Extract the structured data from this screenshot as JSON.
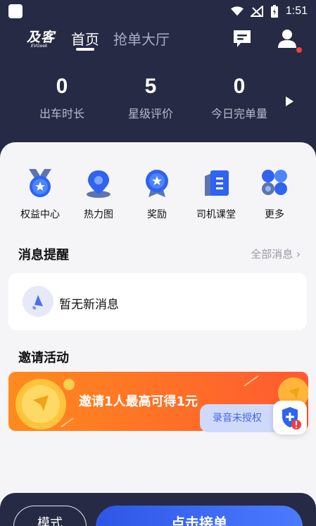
{
  "status_bar": {
    "time": "1:51"
  },
  "header": {
    "logo_main": "及客",
    "logo_sub": "EVGeek",
    "tabs": [
      {
        "label": "首页",
        "active": true
      },
      {
        "label": "抢单大厅",
        "active": false
      }
    ],
    "notification_dot_color": "#f0413d"
  },
  "stats": [
    {
      "value": "0",
      "label": "出车时长"
    },
    {
      "value": "5",
      "label": "星级评价"
    },
    {
      "value": "0",
      "label": "今日完单量"
    }
  ],
  "quick_actions": [
    {
      "label": "权益中心",
      "icon": "medal-icon"
    },
    {
      "label": "热力图",
      "icon": "map-pin-icon"
    },
    {
      "label": "奖励",
      "icon": "award-icon"
    },
    {
      "label": "司机课堂",
      "icon": "book-icon"
    },
    {
      "label": "更多",
      "icon": "grid-more-icon"
    }
  ],
  "messages": {
    "title": "消息提醒",
    "view_all": "全部消息 ›",
    "empty_text": "暂无新消息"
  },
  "invite": {
    "title": "邀请活动",
    "banner_text": "邀请1人最高可得1元"
  },
  "recording_chip": "录音未授权",
  "bottom": {
    "mode_label": "模式",
    "accept_label": "点击接单"
  },
  "colors": {
    "header_bg": "#262a44",
    "accent_blue": "#3d6af2",
    "banner_orange": "#ff6a2a"
  }
}
